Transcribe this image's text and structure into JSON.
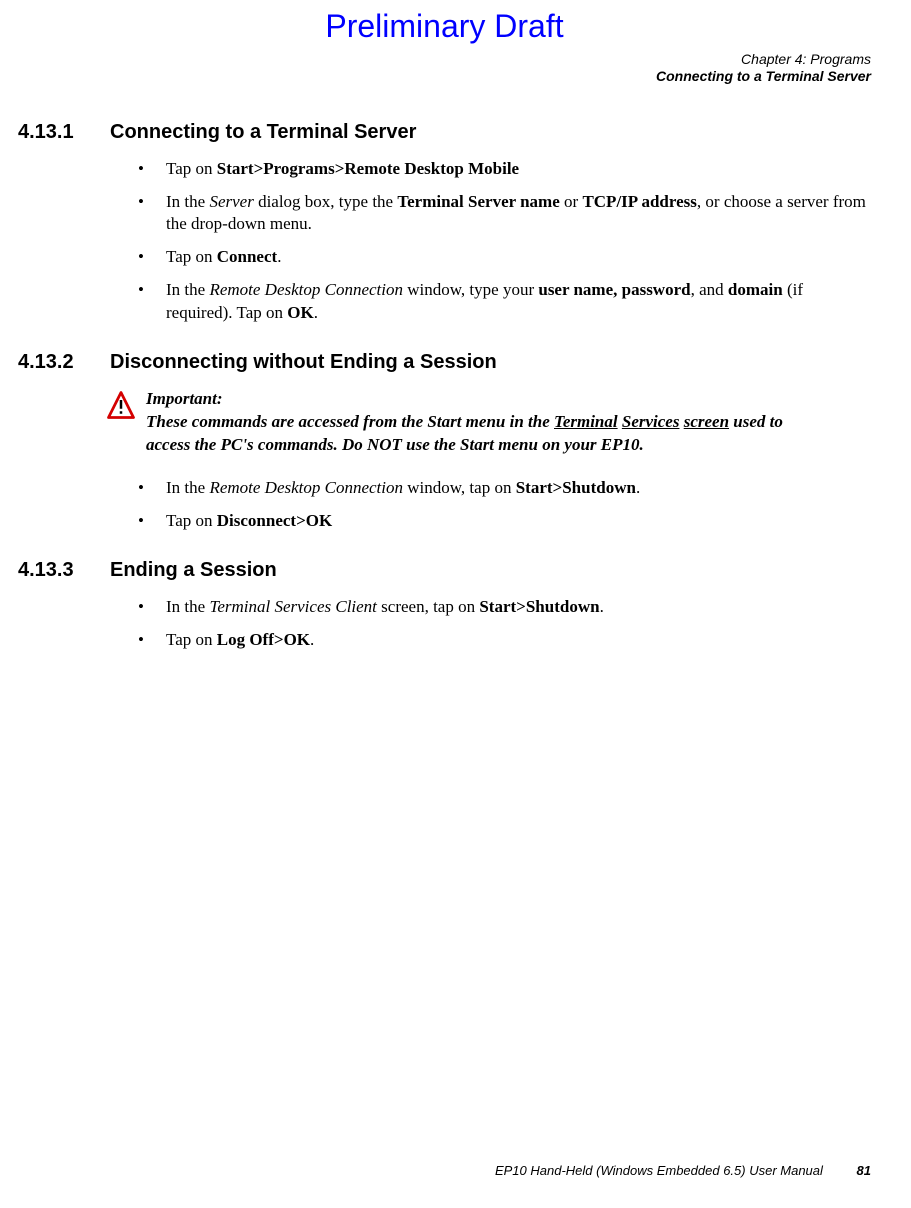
{
  "watermark": "Preliminary Draft",
  "header": {
    "line1": "Chapter 4: Programs",
    "line2": "Connecting to a Terminal Server"
  },
  "sections": {
    "0": {
      "number": "4.13.1",
      "title": "Connecting to a Terminal Server",
      "items": {
        "0": {
          "pre": "Tap on ",
          "bold1": "Start>Programs>Remote Desktop Mobile"
        },
        "1": {
          "t0": "In the ",
          "t1": "Server",
          "t2": " dialog box, type the ",
          "t3": "Terminal Server name",
          "t4": " or ",
          "t5": "TCP/IP address",
          "t6": ", or choose a server from the drop-down menu."
        },
        "2": {
          "t0": "Tap on ",
          "t1": "Connect",
          "t2": "."
        },
        "3": {
          "t0": "In the ",
          "t1": "Remote Desktop Connection",
          "t2": " window, type your ",
          "t3": "user name, password",
          "t4": ", and ",
          "t5": "domain",
          "t6": " (if required). Tap on ",
          "t7": "OK",
          "t8": "."
        }
      }
    },
    "1": {
      "number": "4.13.2",
      "title": "Disconnecting without Ending a Session",
      "important": {
        "label": "Important:",
        "t0": "These commands are accessed from the Start menu in the ",
        "t1": "Terminal",
        "t2": " ",
        "t3": "Services",
        "t4": " ",
        "t5": "screen",
        "t6": " used to access the PC's commands. Do NOT use the Start menu on your EP10."
      },
      "items": {
        "0": {
          "t0": "In the ",
          "t1": "Remote Desktop Connection",
          "t2": " window, tap on ",
          "t3": "Start>Shutdown",
          "t4": "."
        },
        "1": {
          "t0": "Tap on ",
          "t1": "Disconnect>OK"
        }
      }
    },
    "2": {
      "number": "4.13.3",
      "title": "Ending a Session",
      "items": {
        "0": {
          "t0": "In the ",
          "t1": "Terminal Services Client",
          "t2": " screen, tap on ",
          "t3": "Start>Shutdown",
          "t4": "."
        },
        "1": {
          "t0": "Tap on ",
          "t1": "Log Off>OK",
          "t2": "."
        }
      }
    }
  },
  "footer": {
    "text": "EP10 Hand-Held (Windows Embedded 6.5) User Manual",
    "page": "81"
  }
}
